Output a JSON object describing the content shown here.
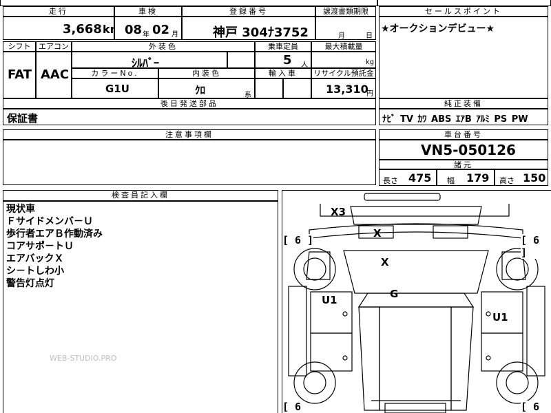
{
  "top": {
    "mileage_header": "走行",
    "mileage_value": "3,668",
    "mileage_unit": "km",
    "inspection_header": "車検",
    "inspection_year": "08",
    "inspection_year_unit": "年",
    "inspection_month": "02",
    "inspection_month_unit": "月",
    "registration_header": "登録番号",
    "registration_value": "神戸 304ﾅ3752",
    "transfer_header": "譲渡書類期限",
    "transfer_month_unit": "月",
    "transfer_day_unit": "日"
  },
  "row2": {
    "shift_header": "シフト",
    "shift_value": "FAT",
    "ac_header": "エアコン",
    "ac_value": "AAC",
    "exterior_header": "外装色",
    "exterior_value": "ｼﾙﾊﾞｰ",
    "capacity_header": "乗車定員",
    "capacity_value": "5",
    "capacity_unit": "人",
    "load_header": "最大積載量",
    "load_unit": "kg",
    "color_no_header": "カラーNo.",
    "color_no_value": "G1U",
    "interior_header": "内装色",
    "interior_value": "ｸﾛ",
    "interior_suffix": "系",
    "import_header": "輸入車",
    "recycle_header": "リサイクル預託金",
    "recycle_value": "13,310",
    "recycle_unit": "円"
  },
  "shipping": {
    "header": "後日発送部品",
    "value": "保証書"
  },
  "notes": {
    "header": "注意事項欄"
  },
  "selling_points": {
    "header": "セールスポイント",
    "value": "★オークションデビュー★"
  },
  "equipment": {
    "header": "純正装備",
    "value": "ﾅﾋﾞ TV ｶﾜ ABS ｴｱB ｱﾙﾐ PS PW"
  },
  "chassis": {
    "header": "車台番号",
    "value": "VN5-050126"
  },
  "dimensions": {
    "header": "諸元",
    "length_label": "長さ",
    "length_value": "475",
    "width_label": "幅",
    "width_value": "179",
    "height_label": "高さ",
    "height_value": "150"
  },
  "inspector": {
    "header": "検査員記入欄",
    "lines": [
      "現状車",
      "Ｆサイドメンバ－Ｕ",
      "歩行者エアＢ作動済み",
      "コアサポ－トＵ",
      "エアバックＸ",
      "シ－トしわ小",
      "警告灯点灯"
    ]
  },
  "watermark": "WEB-STUDIO.PRO",
  "diagram": {
    "marks": {
      "x3": "X3",
      "x_a": "X",
      "x_b": "X",
      "g": "G",
      "u1_left": "U1",
      "u1_right": "U1"
    },
    "tires": {
      "fl": "[ 6 ]",
      "fr": "[ 6 ]",
      "rl": "[ 6",
      "rr": "[ 6"
    }
  }
}
